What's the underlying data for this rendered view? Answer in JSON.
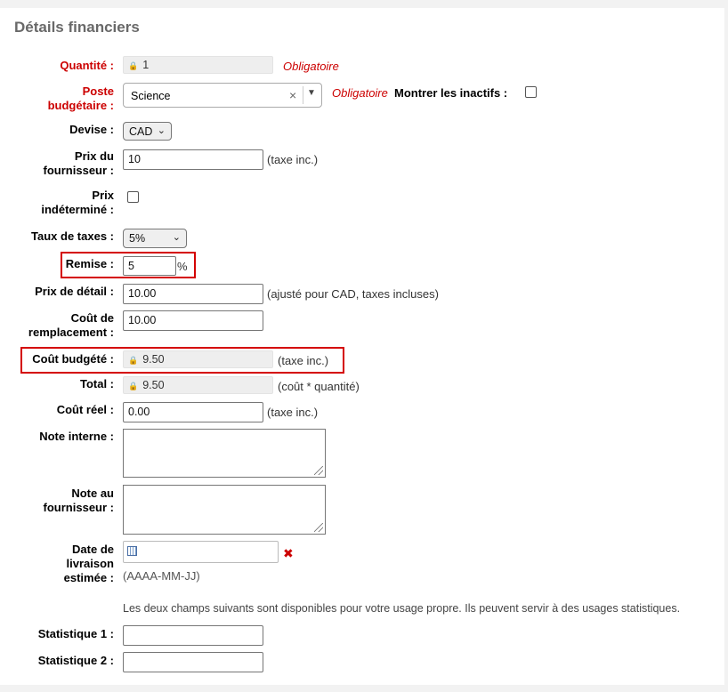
{
  "title": "Détails financiers",
  "required_text": "Obligatoire",
  "quantity": {
    "label": "Quantité :",
    "value": "1"
  },
  "budget": {
    "label_line1": "Poste",
    "label_line2": "budgétaire :",
    "value": "Science",
    "clear": "×",
    "show_inactive_label": "Montrer les inactifs :"
  },
  "currency": {
    "label": "Devise :",
    "value": "CAD"
  },
  "vendor_price": {
    "label_line1": "Prix du",
    "label_line2": "fournisseur :",
    "value": "10",
    "note": "(taxe inc.)"
  },
  "uncertain_price": {
    "label_line1": "Prix",
    "label_line2": "indéterminé :"
  },
  "tax_rate": {
    "label": "Taux de taxes :",
    "value": "5%"
  },
  "discount": {
    "label": "Remise :",
    "value": "5",
    "unit": "%"
  },
  "retail_price": {
    "label": "Prix de détail :",
    "value": "10.00",
    "note": "(ajusté pour CAD, taxes incluses)"
  },
  "replacement_cost": {
    "label_line1": "Coût de",
    "label_line2": "remplacement :",
    "value": "10.00"
  },
  "budgeted_cost": {
    "label": "Coût budgété :",
    "value": "9.50",
    "note": "(taxe inc.)"
  },
  "total": {
    "label": "Total :",
    "value": "9.50",
    "note": "(coût * quantité)"
  },
  "actual_cost": {
    "label": "Coût réel :",
    "value": "0.00",
    "note": "(taxe inc.)"
  },
  "internal_note": {
    "label": "Note interne :"
  },
  "vendor_note": {
    "label_line1": "Note au",
    "label_line2": "fournisseur :"
  },
  "delivery_date": {
    "label_line1": "Date de",
    "label_line2": "livraison",
    "label_line3": "estimée :",
    "value": "",
    "format_hint": "(AAAA-MM-JJ)",
    "clear": "✖"
  },
  "stats_info": "Les deux champs suivants sont disponibles pour votre usage propre. Ils peuvent servir à des usages statistiques.",
  "stat1": {
    "label": "Statistique 1 :",
    "value": ""
  },
  "stat2": {
    "label": "Statistique 2 :",
    "value": ""
  },
  "colors": {
    "required": "#cc0000",
    "highlight": "#d40000",
    "readonly_bg": "#eeeeee"
  }
}
